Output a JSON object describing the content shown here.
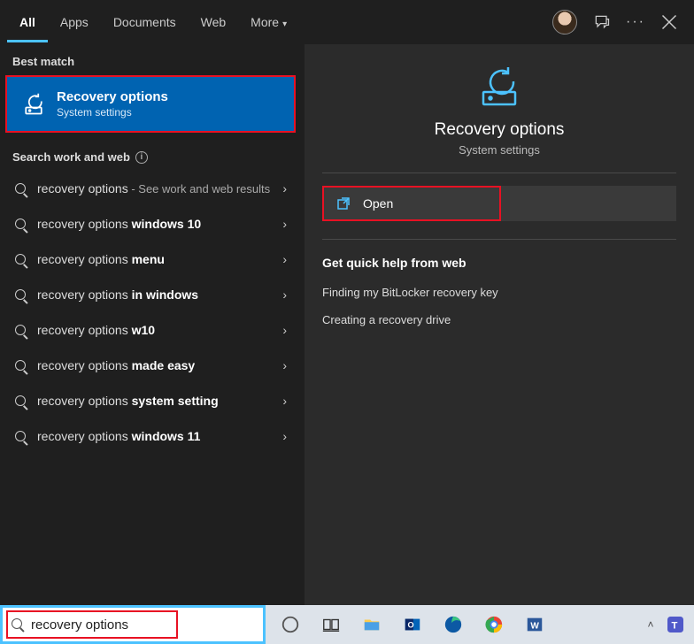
{
  "header": {
    "tabs": [
      "All",
      "Apps",
      "Documents",
      "Web",
      "More"
    ]
  },
  "left": {
    "best_match_label": "Best match",
    "best_match": {
      "title": "Recovery options",
      "subtitle": "System settings"
    },
    "search_web_label": "Search work and web",
    "suggestions": [
      {
        "pre": "recovery options",
        "bold": "",
        "sub": " - See work and web results"
      },
      {
        "pre": "recovery options ",
        "bold": "windows 10",
        "sub": ""
      },
      {
        "pre": "recovery options ",
        "bold": "menu",
        "sub": ""
      },
      {
        "pre": "recovery options ",
        "bold": "in windows",
        "sub": ""
      },
      {
        "pre": "recovery options ",
        "bold": "w10",
        "sub": ""
      },
      {
        "pre": "recovery options ",
        "bold": "made easy",
        "sub": ""
      },
      {
        "pre": "recovery options ",
        "bold": "system setting",
        "sub": ""
      },
      {
        "pre": "recovery options ",
        "bold": "windows 11",
        "sub": ""
      }
    ]
  },
  "right": {
    "title": "Recovery options",
    "subtitle": "System settings",
    "open_label": "Open",
    "quick_head": "Get quick help from web",
    "quick_links": [
      "Finding my BitLocker recovery key",
      "Creating a recovery drive"
    ]
  },
  "search": {
    "value": "recovery options"
  }
}
